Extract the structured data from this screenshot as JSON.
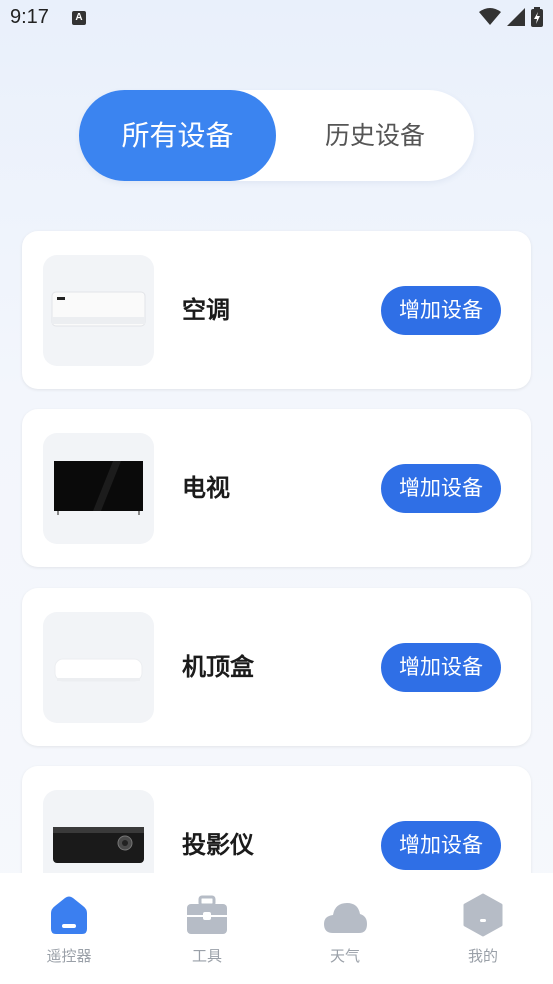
{
  "status": {
    "time": "9:17",
    "ime_letter": "A"
  },
  "tabs": [
    {
      "label": "所有设备",
      "active": true
    },
    {
      "label": "历史设备",
      "active": false
    }
  ],
  "devices": [
    {
      "name": "空调",
      "button": "增加设备",
      "icon": "air-conditioner-icon"
    },
    {
      "name": "电视",
      "button": "增加设备",
      "icon": "tv-icon"
    },
    {
      "name": "机顶盒",
      "button": "增加设备",
      "icon": "set-top-box-icon"
    },
    {
      "name": "投影仪",
      "button": "增加设备",
      "icon": "projector-icon"
    }
  ],
  "nav": [
    {
      "label": "遥控器",
      "icon": "home-icon",
      "active": true
    },
    {
      "label": "工具",
      "icon": "toolbox-icon",
      "active": false
    },
    {
      "label": "天气",
      "icon": "cloud-icon",
      "active": false
    },
    {
      "label": "我的",
      "icon": "profile-hexagon-icon",
      "active": false
    }
  ],
  "colors": {
    "accent": "#3b84f0",
    "button": "#2f6fe6",
    "nav_active": "#3b7ff0",
    "nav_inactive": "#b6bcc6"
  }
}
